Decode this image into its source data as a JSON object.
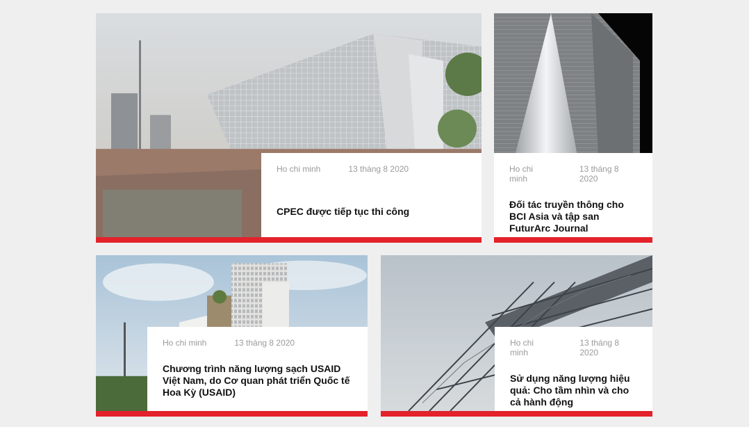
{
  "articles": [
    {
      "location": "Ho chi minh",
      "date": "13 tháng 8 2020",
      "title": "CPEC được tiếp tục thi công",
      "image": "building-glass-facade-plaza"
    },
    {
      "location": "Ho chi minh",
      "date": "13 tháng 8 2020",
      "title": "Đối tác truyền thông cho BCI Asia và tập san FuturArc Journal",
      "image": "building-night-facade"
    },
    {
      "location": "Ho chi minh",
      "date": "13 tháng 8 2020",
      "title": "Chương trình năng lượng sạch USAID Việt Nam, do Cơ quan phát triển Quốc tế Hoa Kỳ (USAID)",
      "image": "tower-building-sky"
    },
    {
      "location": "Ho chi minh",
      "date": "13 tháng 8 2020",
      "title": "Sử dụng năng lượng hiệu quả: Cho tầm nhìn và cho cả hành động",
      "image": "steel-roof-structure"
    }
  ],
  "colors": {
    "accent": "#e3222b",
    "background": "#efefef",
    "meta_text": "#9a9a9a",
    "title_text": "#111111"
  }
}
